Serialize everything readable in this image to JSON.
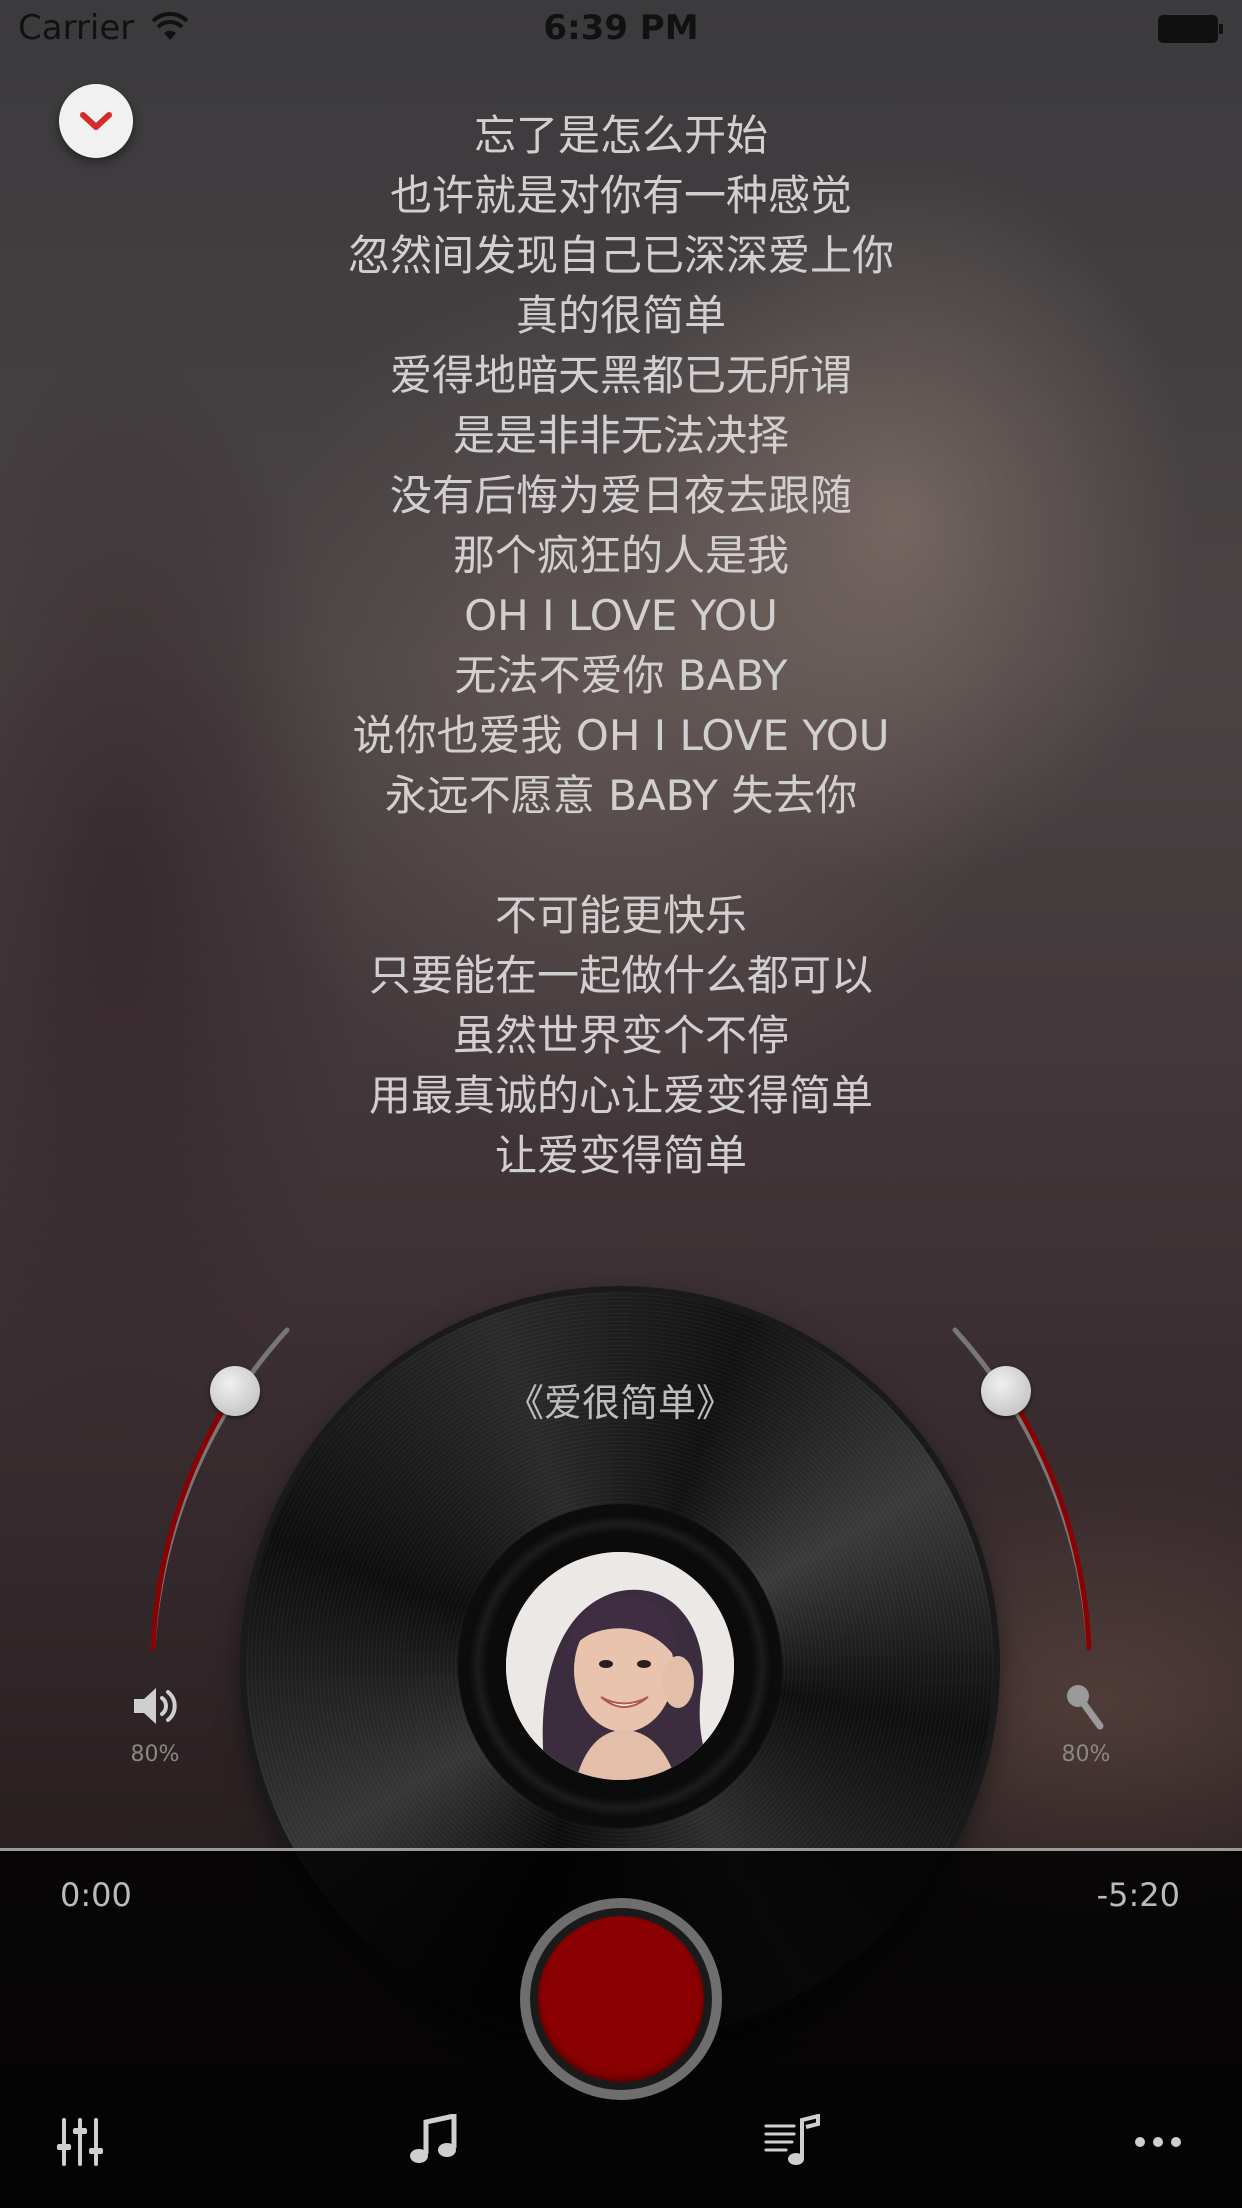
{
  "status_bar": {
    "carrier": "Carrier",
    "time": "6:39 PM"
  },
  "icons": {
    "collapse": "chevron-down-icon",
    "wifi": "wifi-icon",
    "battery": "battery-icon",
    "volume": "speaker-icon",
    "mic": "microphone-icon",
    "equalizer": "equalizer-icon",
    "music": "music-note-icon",
    "playlist": "playlist-icon",
    "more": "more-icon"
  },
  "lyrics": [
    "忘了是怎么开始",
    "也许就是对你有一种感觉",
    "忽然间发现自己已深深爱上你",
    "真的很简单",
    "爱得地暗天黑都已无所谓",
    "是是非非无法决择",
    "没有后悔为爱日夜去跟随",
    "那个疯狂的人是我",
    "OH I LOVE YOU",
    "无法不爱你 BABY",
    "说你也爱我 OH I LOVE YOU",
    "永远不愿意 BABY 失去你",
    "",
    "不可能更快乐",
    "只要能在一起做什么都可以",
    "虽然世界变个不停",
    "用最真诚的心让爱变得简单",
    "让爱变得简单"
  ],
  "song": {
    "title": "《爱很简单》"
  },
  "volume": {
    "label": "80%",
    "level": 0.8
  },
  "mic": {
    "label": "80%",
    "level": 0.8
  },
  "playback": {
    "elapsed": "0:00",
    "remaining": "-5:20"
  },
  "colors": {
    "accent": "#8b0000",
    "arc": "#8b0000",
    "lyric_text": "#d2cfd0"
  }
}
